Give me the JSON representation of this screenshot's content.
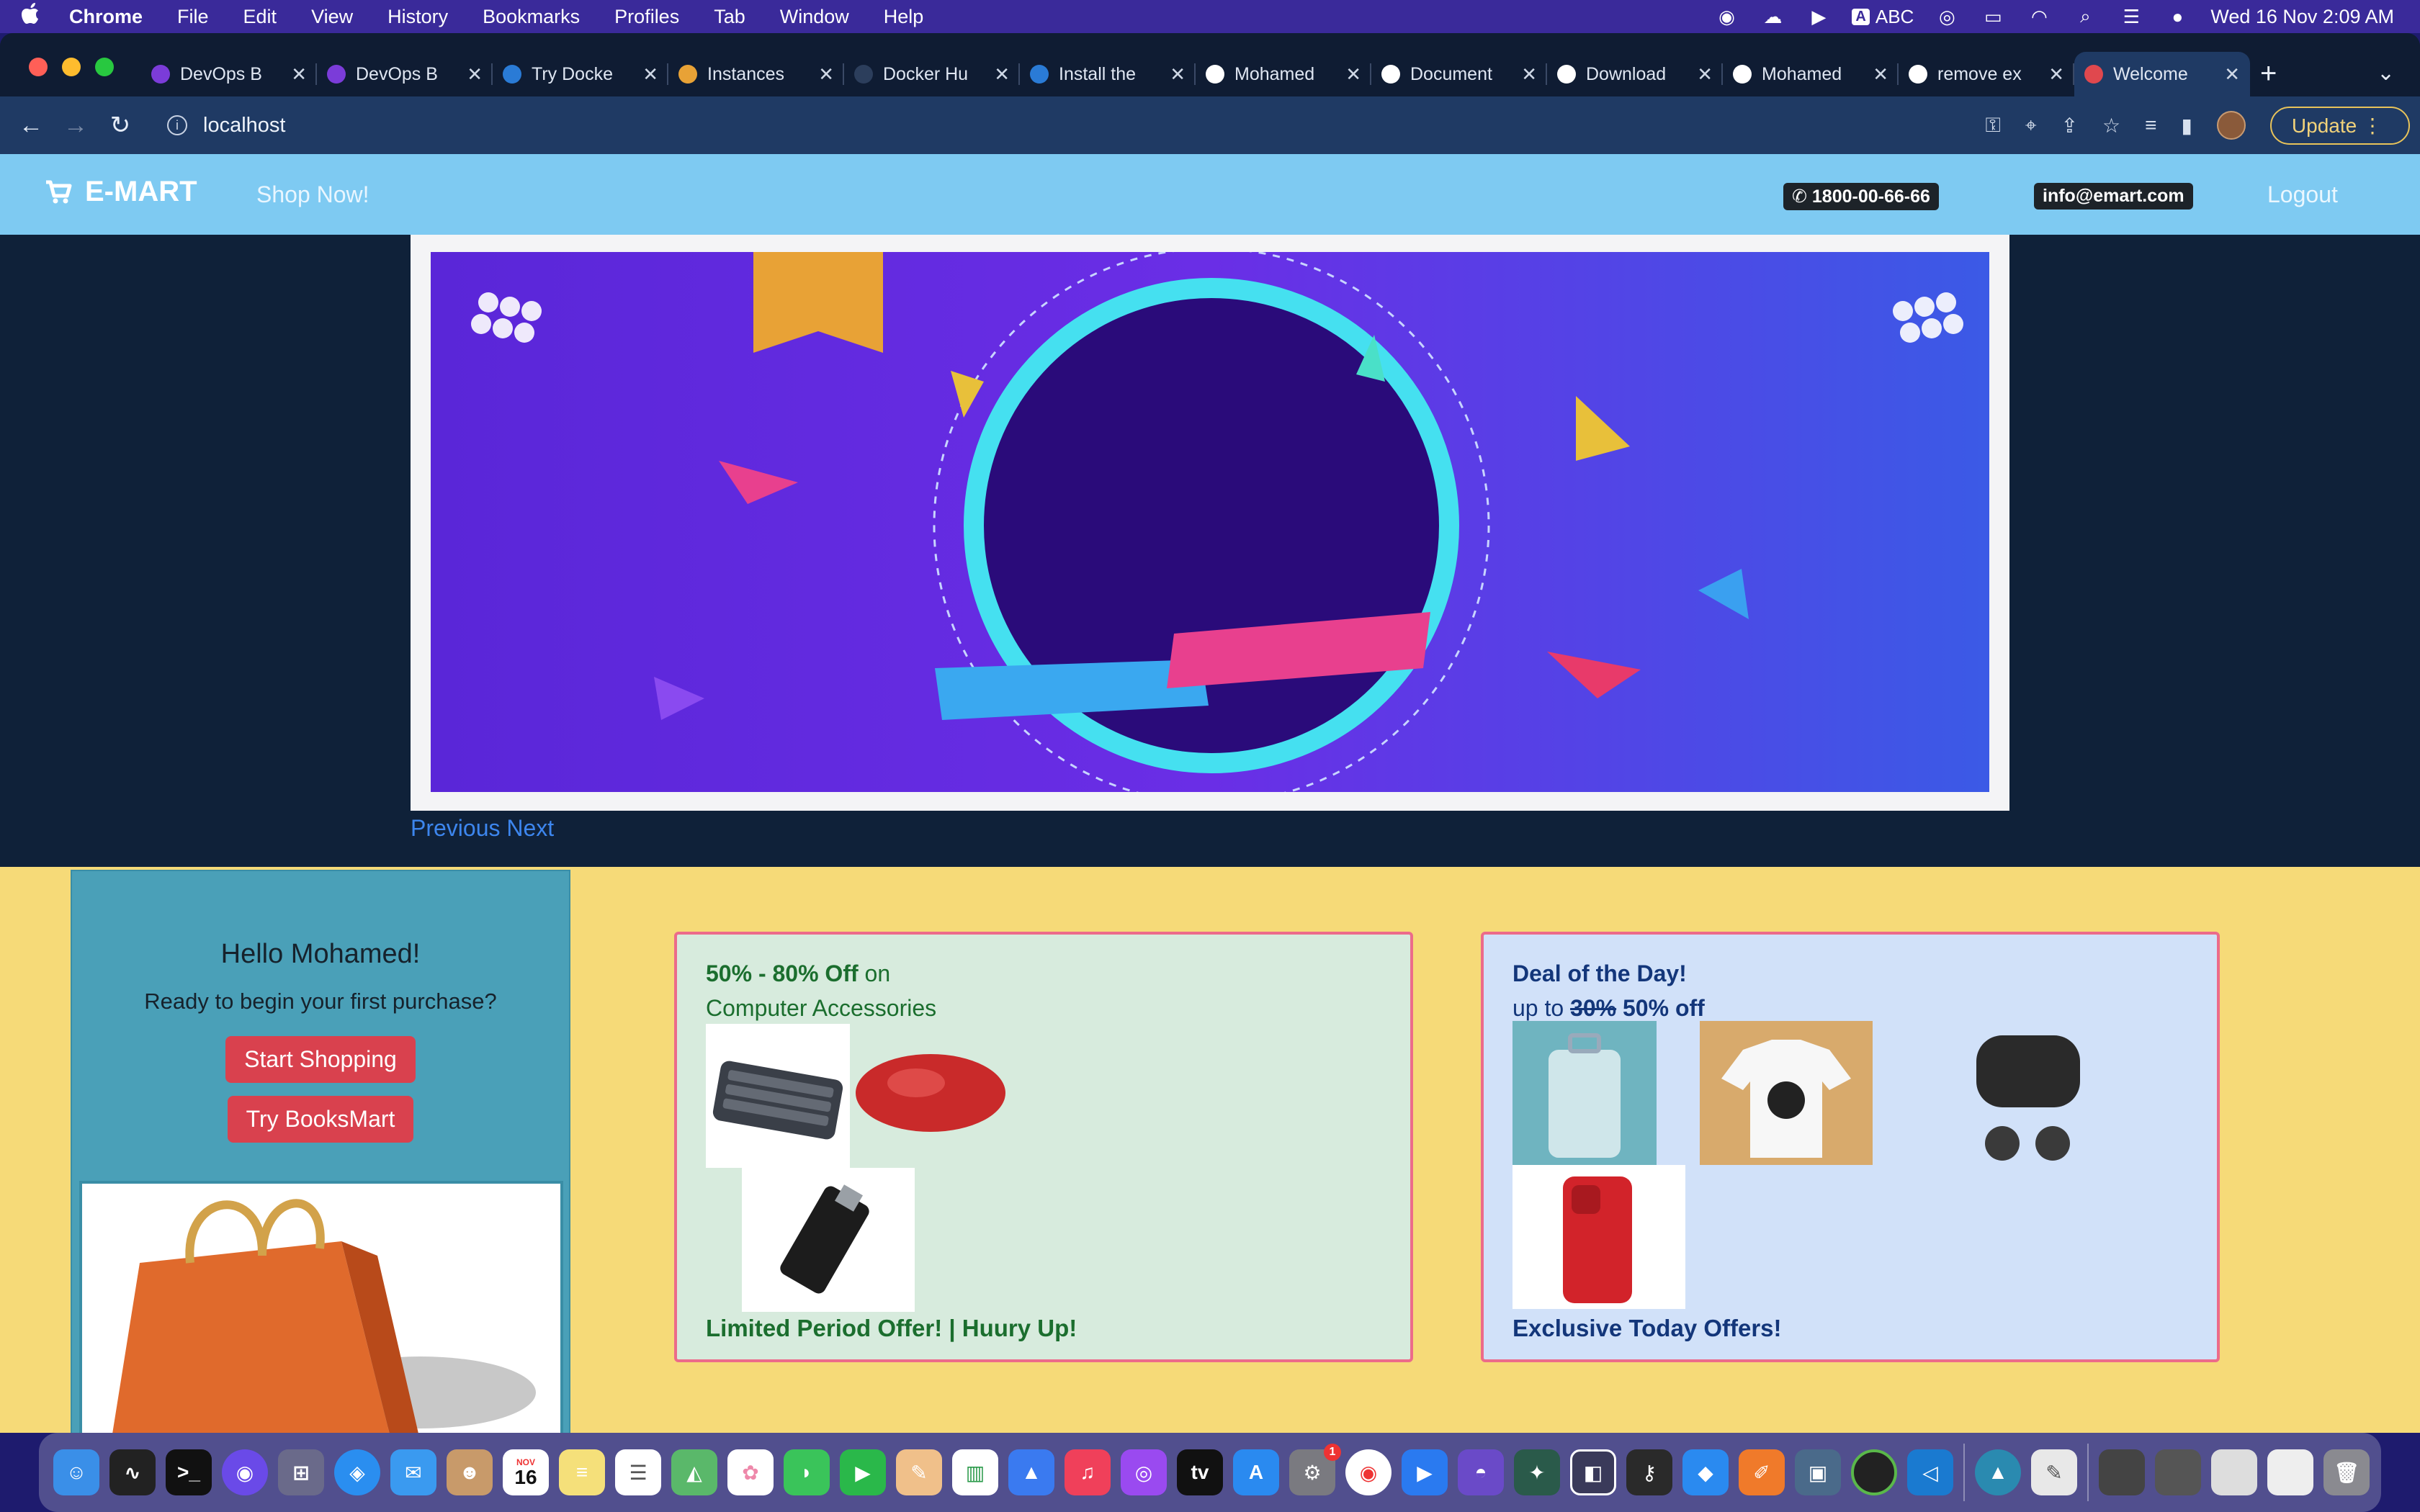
{
  "menubar": {
    "apple": "",
    "items": [
      "Chrome",
      "File",
      "Edit",
      "View",
      "History",
      "Bookmarks",
      "Profiles",
      "Tab",
      "Window",
      "Help"
    ],
    "input_source": "ABC",
    "clock": "Wed 16 Nov  2:09 AM"
  },
  "browser": {
    "tabs": [
      {
        "title": "DevOps B",
        "favicon": "devops-icon",
        "color": "#7b3cd9"
      },
      {
        "title": "DevOps B",
        "favicon": "devops-icon",
        "color": "#7b3cd9"
      },
      {
        "title": "Try Docke",
        "favicon": "docker-icon",
        "color": "#2a7bd6"
      },
      {
        "title": "Instances",
        "favicon": "aws-icon",
        "color": "#e8a236"
      },
      {
        "title": "Docker Hu",
        "favicon": "docker-icon",
        "color": "#2c3e5c"
      },
      {
        "title": "Install the",
        "favicon": "docker-icon",
        "color": "#2a7bd6"
      },
      {
        "title": "Mohamed",
        "favicon": "github-icon",
        "color": "#ffffff"
      },
      {
        "title": "Document",
        "favicon": "globe-icon",
        "color": "#ffffff"
      },
      {
        "title": "Download",
        "favicon": "download-icon",
        "color": "#ffffff"
      },
      {
        "title": "Mohamed",
        "favicon": "github-icon",
        "color": "#ffffff"
      },
      {
        "title": "remove ex",
        "favicon": "google-icon",
        "color": "#ffffff"
      },
      {
        "title": "Welcome",
        "favicon": "cart-icon",
        "color": "#e0484e"
      }
    ],
    "url": "localhost",
    "update_label": "Update"
  },
  "site": {
    "brand": "E-MART",
    "shop_now": "Shop Now!",
    "phone": "1800-00-66-66",
    "email": "info@emart.com",
    "logout": "Logout",
    "carousel": {
      "previous": "Previous",
      "next": "Next"
    },
    "hello": {
      "greeting": "Hello Mohamed!",
      "subtitle": "Ready to begin your first purchase?",
      "start_shopping": "Start Shopping",
      "try_booksmart": "Try BooksMart"
    },
    "offer1": {
      "headline_bold": "50% - 80% Off",
      "headline_rest": " on",
      "line2": "Computer Accessories",
      "footer": "Limited Period Offer! | Huury Up!"
    },
    "offer2": {
      "line1": "Deal of the Day!",
      "up_to": "up to ",
      "old_discount": "30%",
      "new_discount": " 50% off",
      "footer": "Exclusive Today Offers!"
    }
  },
  "dock": {
    "calendar_month": "NOV",
    "calendar_day": "16",
    "badge": "1"
  }
}
